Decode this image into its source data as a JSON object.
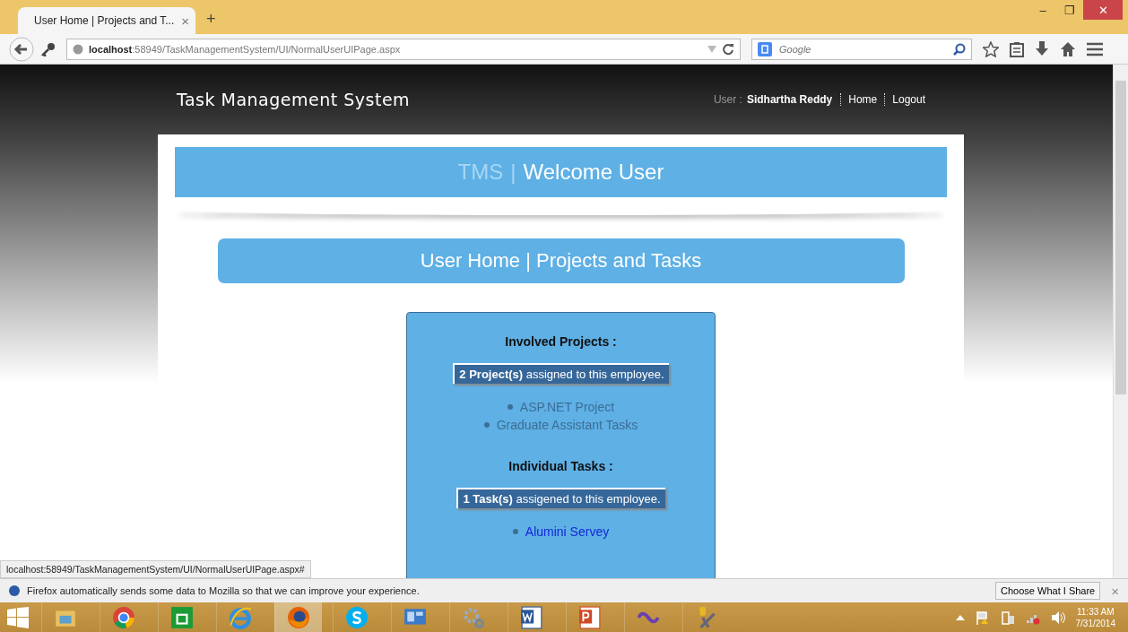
{
  "browser": {
    "tab": {
      "title": "User Home | Projects and T...",
      "close": "×",
      "selected": true
    },
    "new_tab": "+",
    "window_buttons": [
      "–",
      "❐",
      "✕"
    ],
    "url": {
      "host": "localhost",
      "path": ":58949/TaskManagementSystem/UI/NormalUserUIPage.aspx"
    },
    "search": {
      "placeholder": "Google"
    },
    "status_url": "localhost:58949/TaskManagementSystem/UI/NormalUserUIPage.aspx#"
  },
  "header": {
    "site_title": "Task Management System",
    "user_label": "User :",
    "user_name": "Sidhartha Reddy",
    "links": [
      "Home",
      "Logout"
    ]
  },
  "welcome_banner": {
    "brand": "TMS",
    "separator": "|",
    "title": "Welcome User"
  },
  "section_banner": "User Home | Projects and Tasks",
  "card": {
    "sections": [
      {
        "heading": "Involved Projects :",
        "summary": "**2 Project(s)** assigned to this employee.",
        "items": [
          {
            "label": "ASP.NET Project",
            "linked": false
          },
          {
            "label": "Graduate Assistant Tasks",
            "linked": false
          }
        ]
      },
      {
        "heading": "Individual Tasks :",
        "summary": "**1 Task(s)** assigened to this employee.",
        "items": [
          {
            "label": "Alumini Servey",
            "linked": true
          }
        ]
      }
    ]
  },
  "notification": {
    "message": "Firefox automatically sends some data to Mozilla so that we can improve your experience.",
    "button": "Choose What I Share",
    "close": "×"
  },
  "taskbar": {
    "apps": [
      {
        "kind": "explorer",
        "selected": false
      },
      {
        "kind": "chrome",
        "selected": false
      },
      {
        "kind": "store",
        "selected": false
      },
      {
        "kind": "ie",
        "selected": false
      },
      {
        "kind": "firefox",
        "selected": true
      },
      {
        "kind": "skype",
        "selected": false
      },
      {
        "kind": "panel",
        "selected": false
      },
      {
        "kind": "gears",
        "selected": false
      },
      {
        "kind": "word",
        "selected": false
      },
      {
        "kind": "powerpoint",
        "selected": false
      },
      {
        "kind": "vs",
        "selected": false
      },
      {
        "kind": "tools",
        "selected": false
      }
    ],
    "time": "11:33 AM",
    "date": "7/31/2014"
  }
}
